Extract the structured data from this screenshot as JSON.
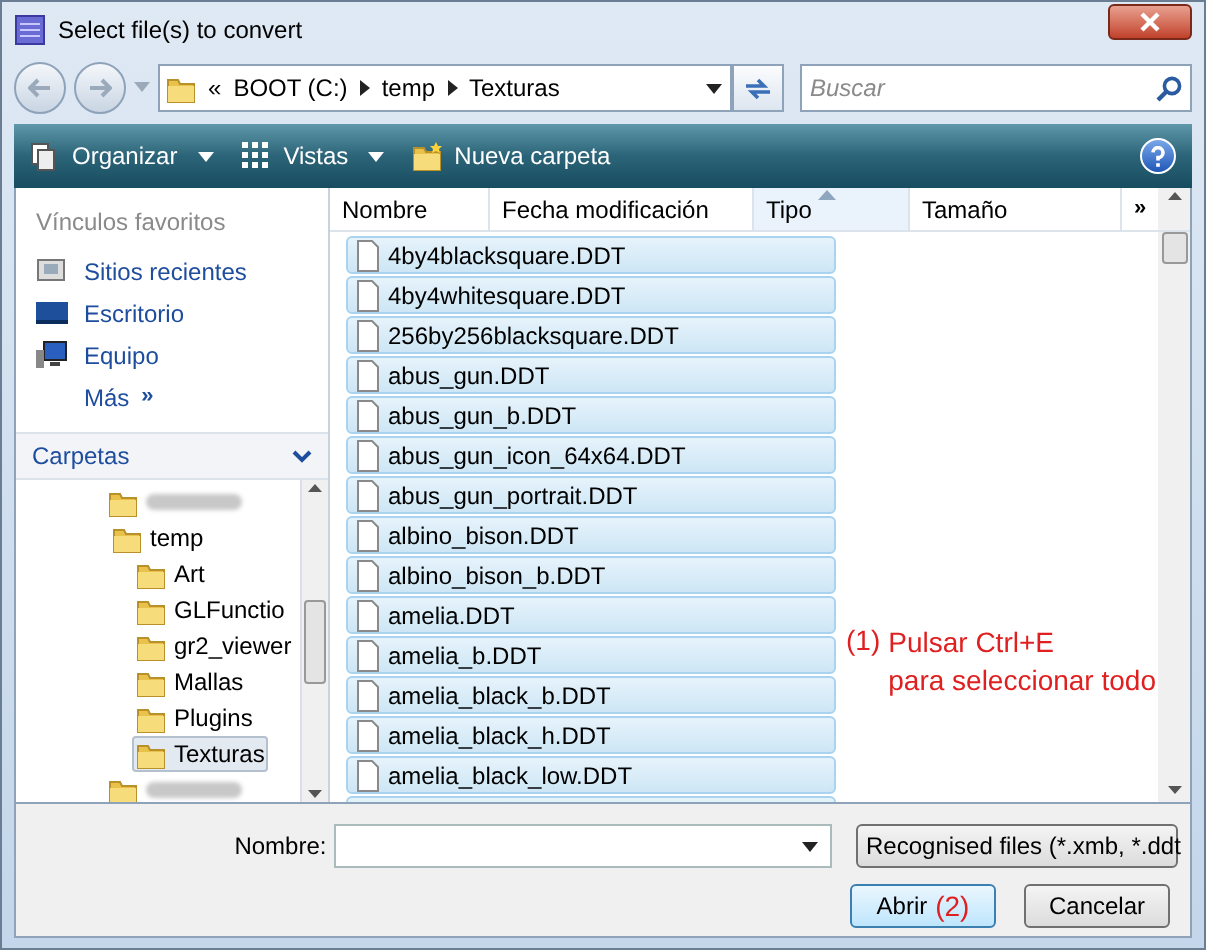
{
  "window": {
    "title": "Select file(s) to convert"
  },
  "address_bar": {
    "segments": [
      "BOOT (C:)",
      "temp",
      "Texturas"
    ],
    "overflow": "«"
  },
  "search": {
    "placeholder": "Buscar"
  },
  "toolbar": {
    "items": [
      "Organizar",
      "Vistas",
      "Nueva carpeta"
    ]
  },
  "favorites": {
    "heading": "Vínculos favoritos",
    "items": [
      "Sitios recientes",
      "Escritorio",
      "Equipo"
    ],
    "more": "Más",
    "more_glyph": "»"
  },
  "folders": {
    "heading": "Carpetas",
    "tree": [
      {
        "kind": "blurred"
      },
      {
        "kind": "folder",
        "label": "temp",
        "selected": false,
        "children": [
          {
            "kind": "folder",
            "label": "Art",
            "selected": false
          },
          {
            "kind": "folder",
            "label": "GLFunctio",
            "selected": false
          },
          {
            "kind": "folder",
            "label": "gr2_viewer",
            "selected": false
          },
          {
            "kind": "folder",
            "label": "Mallas",
            "selected": false
          },
          {
            "kind": "folder",
            "label": "Plugins",
            "selected": false
          },
          {
            "kind": "folder",
            "label": "Texturas",
            "selected": true
          }
        ]
      },
      {
        "kind": "blurred"
      }
    ]
  },
  "file_list": {
    "columns": [
      {
        "label": "Nombre",
        "sorted": false
      },
      {
        "label": "Fecha modificación",
        "sorted": false
      },
      {
        "label": "Tipo",
        "sorted": true
      },
      {
        "label": "Tamaño",
        "sorted": false
      }
    ],
    "more_columns": "»",
    "rows": [
      {
        "name": "4by4blacksquare.DDT",
        "selected": true
      },
      {
        "name": "4by4whitesquare.DDT",
        "selected": true
      },
      {
        "name": "256by256blacksquare.DDT",
        "selected": true
      },
      {
        "name": "abus_gun.DDT",
        "selected": true
      },
      {
        "name": "abus_gun_b.DDT",
        "selected": true
      },
      {
        "name": "abus_gun_icon_64x64.DDT",
        "selected": true
      },
      {
        "name": "abus_gun_portrait.DDT",
        "selected": true
      },
      {
        "name": "albino_bison.DDT",
        "selected": true
      },
      {
        "name": "albino_bison_b.DDT",
        "selected": true
      },
      {
        "name": "amelia.DDT",
        "selected": true
      },
      {
        "name": "amelia_b.DDT",
        "selected": true
      },
      {
        "name": "amelia_black_b.DDT",
        "selected": true
      },
      {
        "name": "amelia_black_h.DDT",
        "selected": true
      },
      {
        "name": "amelia_black_low.DDT",
        "selected": true
      }
    ]
  },
  "annotations": [
    {
      "number": "(1)",
      "text": "Pulsar Ctrl+E",
      "text_2": "para seleccionar todo"
    }
  ],
  "footer": {
    "name_label": "Nombre:",
    "filter": "Recognised files (*.xmb, *.ddt",
    "open_button": "Abrir",
    "open_annotation": "(2)",
    "cancel_button": "Cancelar"
  }
}
